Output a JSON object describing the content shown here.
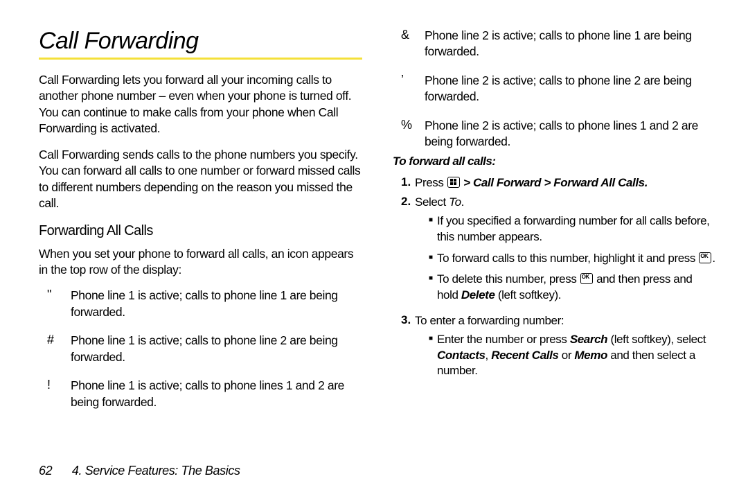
{
  "title": "Call Forwarding",
  "intro1": "Call Forwarding lets you forward all your incoming calls to another phone number – even when your phone is turned off. You can continue to make calls from your phone when Call Forwarding is activated.",
  "intro2": "Call Forwarding sends calls to the phone numbers you specify. You can forward all calls to one number or forward missed calls to different numbers depending on the reason you missed the call.",
  "section_heading": "Forwarding All Calls",
  "section_intro": "When you set your phone to forward all calls, an icon appears in the top row of the display:",
  "icons": [
    {
      "sym": "\"",
      "desc": "Phone line 1 is active; calls to phone line 1 are being forwarded."
    },
    {
      "sym": "#",
      "desc": "Phone line 1 is active; calls to phone line 2 are being forwarded."
    },
    {
      "sym": "!",
      "desc": "Phone line 1 is active; calls to phone lines 1 and 2 are being forwarded."
    },
    {
      "sym": "&",
      "desc": "Phone line 2 is active; calls to phone line 1 are being forwarded."
    },
    {
      "sym": "’",
      "desc": "Phone line 2 is active; calls to phone line 2 are being forwarded."
    },
    {
      "sym": "%",
      "desc": "Phone line 2 is active; calls to phone lines 1 and 2 are being forwarded."
    }
  ],
  "instruction_heading": "To forward all calls:",
  "steps": {
    "s1_pre": "Press ",
    "s1_path": " > Call Forward > Forward All Calls.",
    "s2_pre": "Select ",
    "s2_em": "To",
    "s2_post": ".",
    "sub_a": "If you specified a forwarding number for all calls before, this number appears.",
    "sub_b_pre": "To forward calls to this number, highlight it and press ",
    "sub_b_post": ".",
    "sub_c_pre": "To delete this number, press ",
    "sub_c_mid": " and then press and hold ",
    "sub_c_em": "Delete",
    "sub_c_post": " (left softkey).",
    "s3": "To enter a forwarding number:",
    "sub_d_pre": "Enter the number or press ",
    "sub_d_em1": "Search",
    "sub_d_mid1": " (left softkey), select ",
    "sub_d_em2": "Contacts",
    "sub_d_comma": ", ",
    "sub_d_em3": "Recent Calls",
    "sub_d_or": " or ",
    "sub_d_em4": "Memo",
    "sub_d_post": " and then select a number."
  },
  "footer": {
    "page": "62",
    "chapter": "4. Service Features: The Basics"
  }
}
